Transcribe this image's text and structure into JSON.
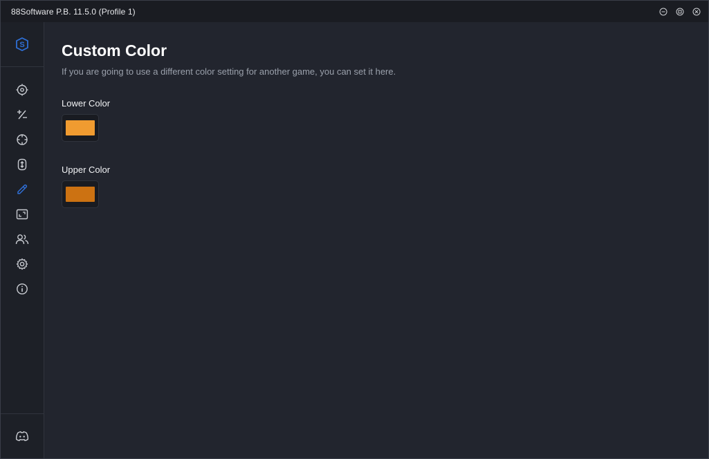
{
  "window": {
    "title": "88Software P.B. 11.5.0 (Profile 1)",
    "buttons": [
      "minimize-icon",
      "maximize-icon",
      "close-icon"
    ]
  },
  "sidebar": {
    "logo": "software-logo",
    "items": [
      {
        "icon": "crosshair-target-icon",
        "active": false
      },
      {
        "icon": "plus-minus-icon",
        "active": false
      },
      {
        "icon": "aim-reticle-icon",
        "active": false
      },
      {
        "icon": "mouse-scroll-icon",
        "active": false
      },
      {
        "icon": "color-picker-icon",
        "active": true
      },
      {
        "icon": "screen-region-icon",
        "active": false
      },
      {
        "icon": "users-icon",
        "active": false
      },
      {
        "icon": "gear-icon",
        "active": false
      },
      {
        "icon": "info-icon",
        "active": false
      }
    ],
    "bottom_icon": "discord-icon"
  },
  "main": {
    "title": "Custom Color",
    "description": "If you are going to use a different color setting for another game, you can set it here.",
    "lower": {
      "label": "Lower Color",
      "color": "#f09b30"
    },
    "upper": {
      "label": "Upper Color",
      "color": "#cc7212"
    }
  },
  "colors": {
    "accent": "#2f6fd6",
    "icon": "#c9ccd2",
    "background": "#22252e",
    "sidebar": "#1d2027"
  }
}
